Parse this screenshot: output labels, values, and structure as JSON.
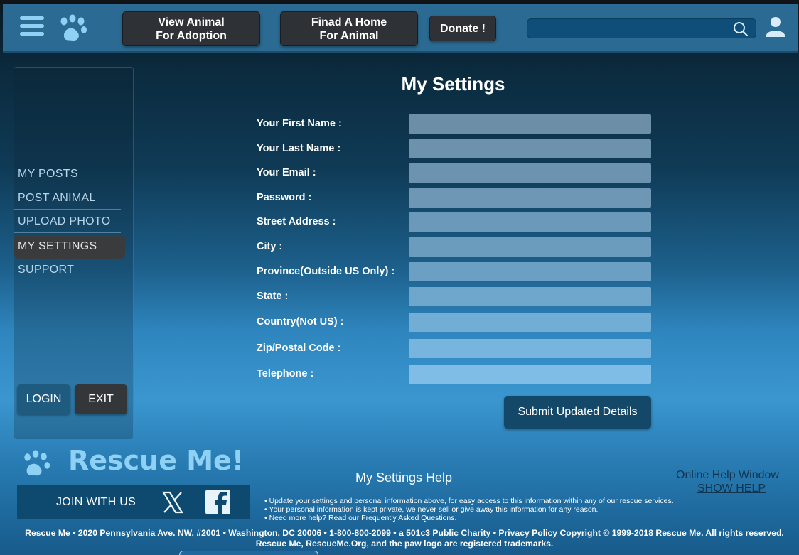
{
  "header": {
    "view_animal_label": "View Animal\nFor Adoption",
    "find_home_label": "Finad A Home\nFor Animal",
    "donate_label": "Donate !",
    "search_placeholder": ""
  },
  "sidebar": {
    "items": [
      {
        "label": "MY POSTS"
      },
      {
        "label": "POST ANIMAL"
      },
      {
        "label": "UPLOAD PHOTO"
      },
      {
        "label": "MY SETTINGS"
      },
      {
        "label": "SUPPORT"
      }
    ],
    "login_label": "LOGIN",
    "exit_label": "EXIT"
  },
  "form": {
    "title": "My Settings",
    "fields": [
      {
        "label": "Your First Name :",
        "value": ""
      },
      {
        "label": "Your Last Name :",
        "value": ""
      },
      {
        "label": "Your Email :",
        "value": ""
      },
      {
        "label": "Password :",
        "value": ""
      },
      {
        "label": "Street Address :",
        "value": ""
      },
      {
        "label": "City :",
        "value": ""
      },
      {
        "label": "Province(Outside US Only) :",
        "value": ""
      },
      {
        "label": "State :",
        "value": ""
      },
      {
        "label": "Country(Not US) :",
        "value": ""
      },
      {
        "label": "Zip/Postal Code :",
        "value": ""
      },
      {
        "label": "Telephone :",
        "value": ""
      }
    ],
    "submit_label": "Submit Updated Details"
  },
  "footer": {
    "brand_name": "Rescue Me!",
    "join_label": "JOIN WITH US",
    "help_title": "My Settings Help",
    "online_help_label": "Online Help Window",
    "show_help_label": "SHOW HELP",
    "help_items": [
      "Update your settings and personal information above, for easy access to this information within any of our rescue services.",
      "Your personal information is kept private, we never sell or give away this information for any reason.",
      "Need more help? Read our Frequently Asked Questions."
    ],
    "legal_line1_before": "Rescue Me • 2020 Pennsylvania Ave. NW, #2001 • Washington, DC 20006 • 1-800-800-2099 • a 501c3 Public Charity • ",
    "privacy_label": "Privacy Policy",
    "legal_line1_after": " Copyright © 1999-2018 Rescue Me. All rights reserved.",
    "legal_line2": "Rescue Me, RescueMe.Org, and the paw logo are registered trademarks."
  },
  "colors": {
    "accent": "#8fd1f4",
    "header_bg": "#2b6b93",
    "button_dark": "#2e3236",
    "submit_bg": "#134868"
  }
}
